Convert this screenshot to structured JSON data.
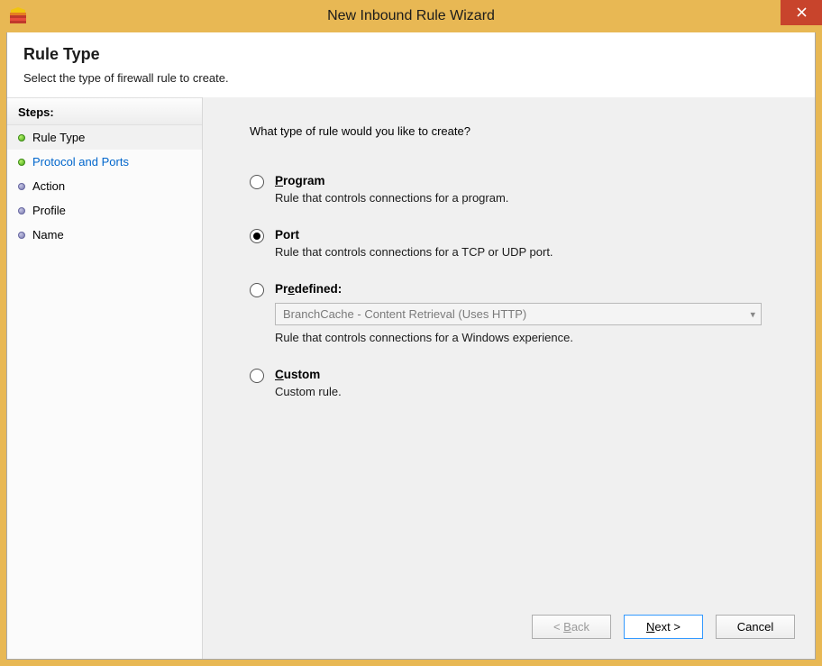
{
  "window": {
    "title": "New Inbound Rule Wizard"
  },
  "header": {
    "title": "Rule Type",
    "subtitle": "Select the type of firewall rule to create."
  },
  "steps": {
    "label": "Steps:",
    "items": [
      {
        "label": "Rule Type",
        "state": "current",
        "bullet": "green"
      },
      {
        "label": "Protocol and Ports",
        "state": "next",
        "bullet": "green"
      },
      {
        "label": "Action",
        "state": "future",
        "bullet": "gray"
      },
      {
        "label": "Profile",
        "state": "future",
        "bullet": "gray"
      },
      {
        "label": "Name",
        "state": "future",
        "bullet": "gray"
      }
    ]
  },
  "content": {
    "question": "What type of rule would you like to create?",
    "options": {
      "program": {
        "accel": "P",
        "rest": "rogram",
        "desc": "Rule that controls connections for a program.",
        "checked": false
      },
      "port": {
        "accel": "",
        "full": "Port",
        "desc": "Rule that controls connections for a TCP or UDP port.",
        "checked": true
      },
      "predefined": {
        "accel": "e",
        "pre": "Pr",
        "rest": "defined:",
        "combo_value": "BranchCache - Content Retrieval (Uses HTTP)",
        "desc": "Rule that controls connections for a Windows experience.",
        "checked": false
      },
      "custom": {
        "accel": "C",
        "rest": "ustom",
        "desc": "Custom rule.",
        "checked": false
      }
    }
  },
  "buttons": {
    "back_pre": "< ",
    "back_accel": "B",
    "back_rest": "ack",
    "next_accel": "N",
    "next_rest": "ext >",
    "cancel": "Cancel"
  }
}
